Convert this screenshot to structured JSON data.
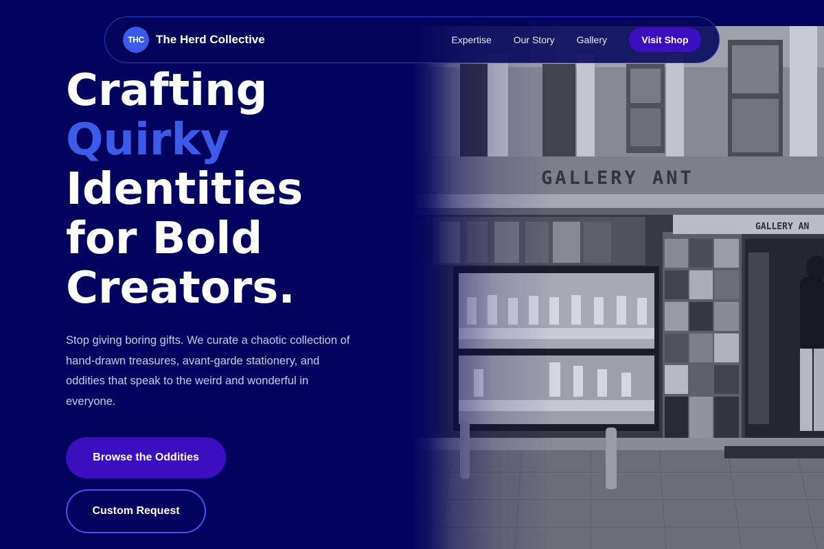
{
  "header": {
    "logo_initials": "THC",
    "brand_name": "The Herd Collective",
    "nav_links": [
      "Expertise",
      "Our Story",
      "Gallery"
    ],
    "cta_label": "Visit Shop"
  },
  "hero": {
    "title_lines": [
      "Crafting",
      "Quirky",
      "Identities",
      "for Bold",
      "Creators."
    ],
    "subtitle": "Stop giving boring gifts. We curate a chaotic collection of hand-drawn treasures, avant-garde stationery, and oddities that speak to the weird and wonderful in everyone.",
    "primary_button": "Browse the Oddities",
    "secondary_button": "Custom Request"
  },
  "photo": {
    "sign_main": "GALLERY ANT",
    "sign_small": "GALLERY AN"
  },
  "colors": {
    "background": "#02035f",
    "accent": "#3b5be8",
    "button_primary": "#3a0fbf",
    "text_muted": "#c9cbee"
  }
}
